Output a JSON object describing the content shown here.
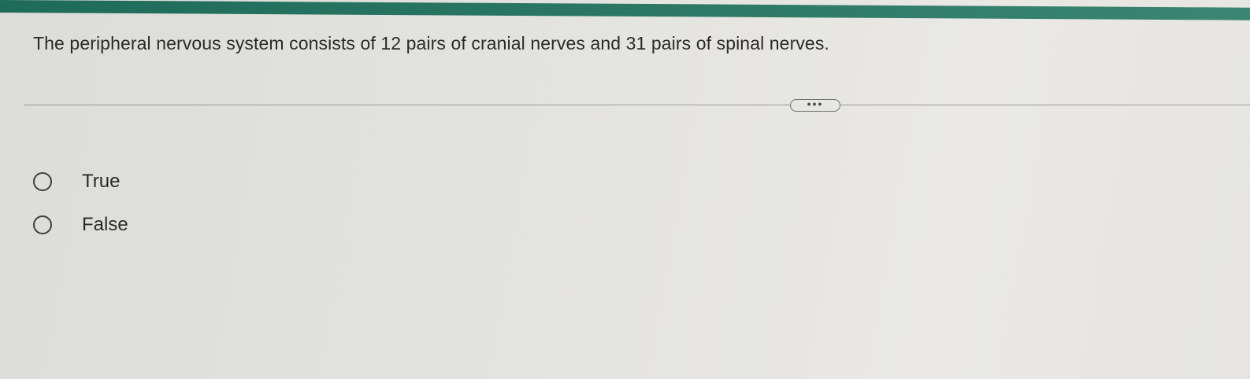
{
  "question": {
    "text": "The peripheral nervous system consists of 12 pairs of cranial nerves and 31 pairs of spinal nerves."
  },
  "more_button": {
    "label": "•••"
  },
  "options": [
    {
      "label": "True",
      "selected": false
    },
    {
      "label": "False",
      "selected": false
    }
  ],
  "colors": {
    "top_bar": "#2d7a66",
    "background": "#e3e3e0",
    "text": "#2a2a2a"
  }
}
